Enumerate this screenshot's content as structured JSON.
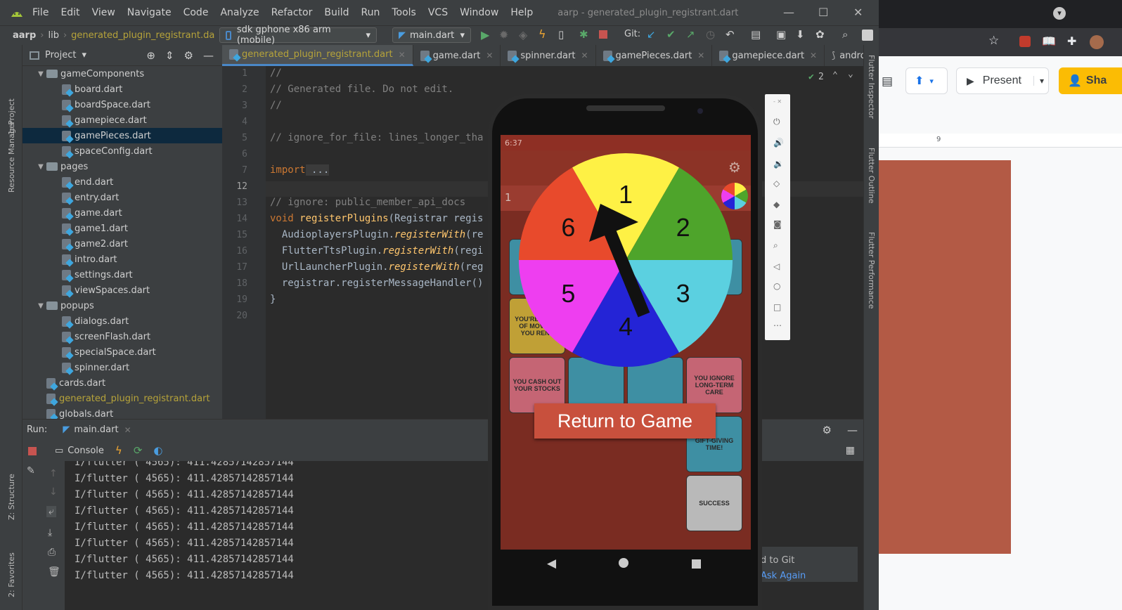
{
  "ide": {
    "menu": [
      "File",
      "Edit",
      "View",
      "Navigate",
      "Code",
      "Analyze",
      "Refactor",
      "Build",
      "Run",
      "Tools",
      "VCS",
      "Window",
      "Help"
    ],
    "window_title": "aarp - generated_plugin_registrant.dart",
    "breadcrumb": {
      "project": "aarp",
      "folder": "lib",
      "file": "generated_plugin_registrant.da"
    },
    "device": "sdk gphone x86 arm (mobile)",
    "run_config": "main.dart",
    "git_label": "Git:",
    "project_panel_title": "Project",
    "tree": [
      {
        "label": "gameComponents",
        "type": "folder",
        "indent": 1
      },
      {
        "label": "board.dart",
        "type": "file",
        "indent": 2
      },
      {
        "label": "boardSpace.dart",
        "type": "file",
        "indent": 2
      },
      {
        "label": "gamepiece.dart",
        "type": "file",
        "indent": 2
      },
      {
        "label": "gamePieces.dart",
        "type": "file",
        "indent": 2,
        "selected": true
      },
      {
        "label": "spaceConfig.dart",
        "type": "file",
        "indent": 2
      },
      {
        "label": "pages",
        "type": "folder",
        "indent": 1
      },
      {
        "label": "end.dart",
        "type": "file",
        "indent": 2
      },
      {
        "label": "entry.dart",
        "type": "file",
        "indent": 2
      },
      {
        "label": "game.dart",
        "type": "file",
        "indent": 2
      },
      {
        "label": "game1.dart",
        "type": "file",
        "indent": 2
      },
      {
        "label": "game2.dart",
        "type": "file",
        "indent": 2
      },
      {
        "label": "intro.dart",
        "type": "file",
        "indent": 2
      },
      {
        "label": "settings.dart",
        "type": "file",
        "indent": 2
      },
      {
        "label": "viewSpaces.dart",
        "type": "file",
        "indent": 2
      },
      {
        "label": "popups",
        "type": "folder",
        "indent": 1
      },
      {
        "label": "dialogs.dart",
        "type": "file",
        "indent": 2
      },
      {
        "label": "screenFlash.dart",
        "type": "file",
        "indent": 2
      },
      {
        "label": "specialSpace.dart",
        "type": "file",
        "indent": 2
      },
      {
        "label": "spinner.dart",
        "type": "file",
        "indent": 2
      },
      {
        "label": "cards.dart",
        "type": "file",
        "indent": 1
      },
      {
        "label": "generated_plugin_registrant.dart",
        "type": "file",
        "indent": 1,
        "highlight": true
      },
      {
        "label": "globals.dart",
        "type": "file",
        "indent": 1
      }
    ],
    "tabs": [
      {
        "label": "generated_plugin_registrant.dart",
        "active": true
      },
      {
        "label": "game.dart"
      },
      {
        "label": "spinner.dart"
      },
      {
        "label": "gamePieces.dart"
      },
      {
        "label": "gamepiece.dart"
      },
      {
        "label": "android\\buil"
      }
    ],
    "inspection_count": "2",
    "line_numbers": [
      "1",
      "2",
      "3",
      "4",
      "5",
      "6",
      "7",
      "12",
      "13",
      "14",
      "15",
      "16",
      "17",
      "18",
      "19",
      "20"
    ],
    "code": {
      "l1": "//",
      "l2": "// Generated file. Do not edit.",
      "l3": "//",
      "l5": "// ignore_for_file: lines_longer_tha",
      "l7_kw": "import",
      "l7_rest": " ...",
      "l13": "// ignore: public_member_api_docs",
      "l14_kw": "void",
      "l14_fn": "registerPlugins",
      "l14_rest": "(Registrar regis",
      "l15_a": "  AudioplayersPlugin.",
      "l15_b": "registerWith",
      "l15_c": "(re",
      "l16_a": "  FlutterTtsPlugin.",
      "l16_b": "registerWith",
      "l16_c": "(regi",
      "l17_a": "  UrlLauncherPlugin.",
      "l17_b": "registerWith",
      "l17_c": "(reg",
      "l18": "  registrar.registerMessageHandler()",
      "l19": "}"
    },
    "run": {
      "label": "Run:",
      "config": "main.dart",
      "console_tab": "Console",
      "partial_line": "I/flutter ( 4565): 411.42857142857144",
      "lines": [
        "I/flutter ( 4565): 411.42857142857144",
        "I/flutter ( 4565): 411.42857142857144",
        "I/flutter ( 4565): 411.42857142857144",
        "I/flutter ( 4565): 411.42857142857144",
        "I/flutter ( 4565): 411.42857142857144",
        "I/flutter ( 4565): 411.42857142857144",
        "I/flutter ( 4565): 411.42857142857144"
      ]
    },
    "left_stripe": [
      "1: Project",
      "Resource Manager",
      "Z: Structure",
      "2: Favorites"
    ],
    "right_stripe": [
      "Flutter Inspector",
      "Flutter Outline",
      "Flutter Performance"
    ],
    "notification": {
      "line1": "d to Git",
      "link": "Ask Again"
    }
  },
  "phone": {
    "status_time": "6:37",
    "strip_label": "1",
    "wheel": [
      {
        "label": "1",
        "color": "#fef145"
      },
      {
        "label": "2",
        "color": "#4ea42b"
      },
      {
        "label": "3",
        "color": "#5bd0e0"
      },
      {
        "label": "4",
        "color": "#2424d6"
      },
      {
        "label": "5",
        "color": "#ee3ef0"
      },
      {
        "label": "6",
        "color": "#e84a2c"
      }
    ],
    "tiles": {
      "t1": "YOU'RE TIRED OF MOVING YOU RENT",
      "t2": "YOU CASH OUT YOUR STOCKS",
      "t3": "YOU IGNORE LONG-TERM CARE",
      "t4": "GIFT-GIVING TIME!",
      "t5": "SUCCESS"
    },
    "return_button": "Return to Game"
  },
  "browser": {
    "present": "Present",
    "share": "Sha",
    "ruler_mark": "9"
  },
  "colors": {
    "accent": "#4a88c7",
    "file_highlight": "#b6a33a",
    "button_red": "#c8503d",
    "slide_color": "#b35a45"
  }
}
